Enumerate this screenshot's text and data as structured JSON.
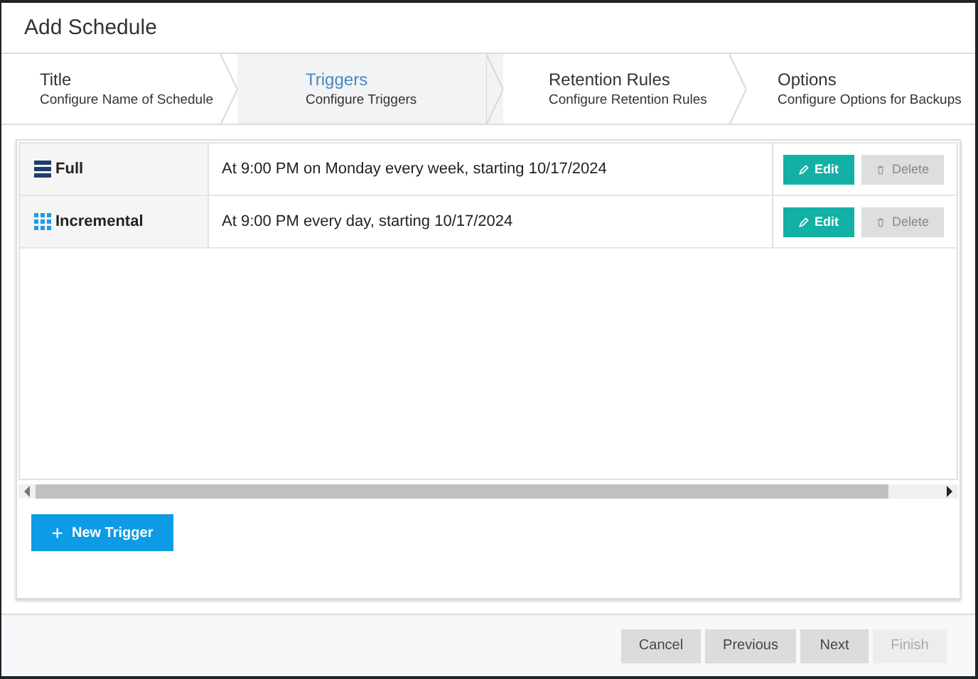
{
  "window": {
    "title": "Add Schedule"
  },
  "steps": [
    {
      "title": "Title",
      "subtitle": "Configure Name of Schedule",
      "selected": false
    },
    {
      "title": "Triggers",
      "subtitle": "Configure Triggers",
      "selected": true
    },
    {
      "title": "Retention Rules",
      "subtitle": "Configure Retention Rules",
      "selected": false
    },
    {
      "title": "Options",
      "subtitle": "Configure Options for Backups",
      "selected": false
    }
  ],
  "triggers": [
    {
      "kind": "full",
      "name": "Full",
      "description": "At 9:00 PM on Monday every week, starting 10/17/2024",
      "edit": "Edit",
      "delete": "Delete"
    },
    {
      "kind": "incremental",
      "name": "Incremental",
      "description": "At 9:00 PM every day, starting 10/17/2024",
      "edit": "Edit",
      "delete": "Delete"
    }
  ],
  "new_trigger": {
    "icon": "+",
    "label": "New Trigger"
  },
  "footer_buttons": [
    {
      "label": "Cancel",
      "disabled": false
    },
    {
      "label": "Previous",
      "disabled": false
    },
    {
      "label": "Next",
      "disabled": false
    },
    {
      "label": "Finish",
      "disabled": true
    }
  ]
}
